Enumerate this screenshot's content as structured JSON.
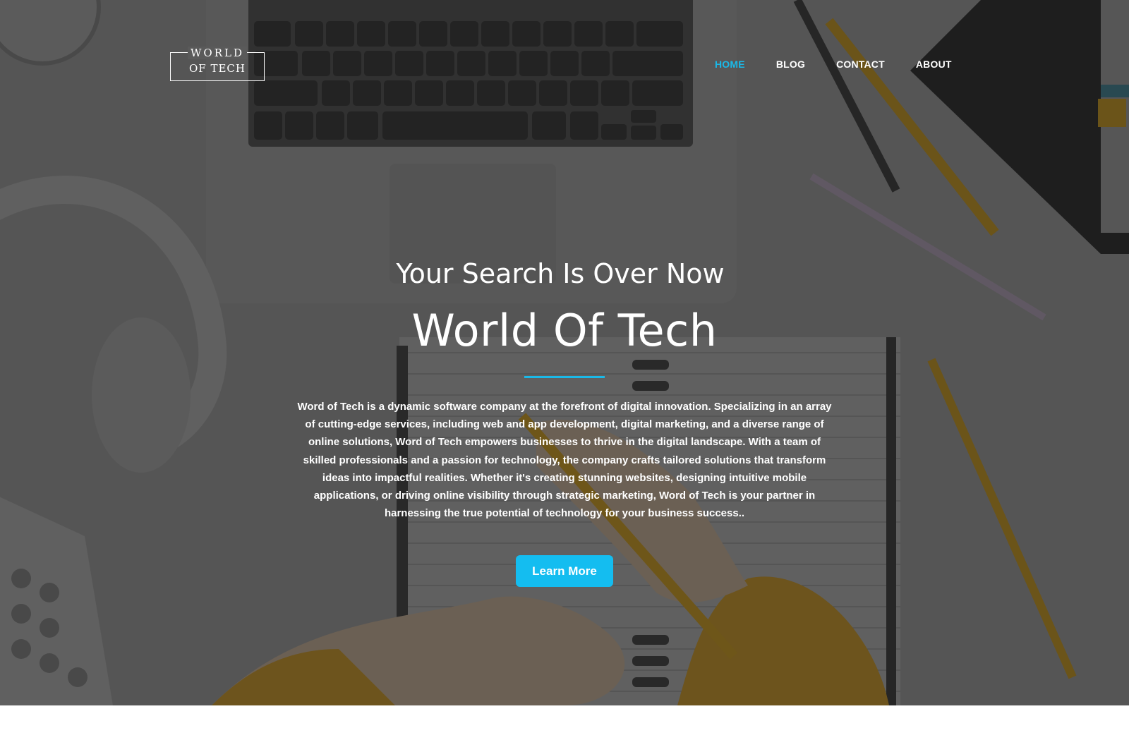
{
  "brand": {
    "logo_line1": "WORLD",
    "logo_line2": "OF TECH"
  },
  "nav": {
    "items": [
      {
        "label": "HOME",
        "active": true
      },
      {
        "label": "BLOG",
        "active": false
      },
      {
        "label": "CONTACT",
        "active": false
      },
      {
        "label": "ABOUT",
        "active": false
      }
    ]
  },
  "hero": {
    "subtitle": "Your Search Is Over Now",
    "title": "World Of Tech",
    "description": "Word of Tech is a dynamic software company at the forefront of digital innovation. Specializing in an array of cutting-edge services, including web and app development, digital marketing, and a diverse range of online solutions, Word of Tech empowers businesses to thrive in the digital landscape. With a team of skilled professionals and a passion for technology, the company crafts tailored solutions that transform ideas into impactful realities. Whether it's creating stunning websites, designing intuitive mobile applications, or driving online visibility through strategic marketing, Word of Tech is your partner in harnessing the true potential of technology for your business success..",
    "cta_label": "Learn More",
    "background_image": "desk-workspace-photo"
  },
  "colors": {
    "accent": "#1ab9e8",
    "button": "#14bdf0",
    "text": "#ffffff"
  }
}
